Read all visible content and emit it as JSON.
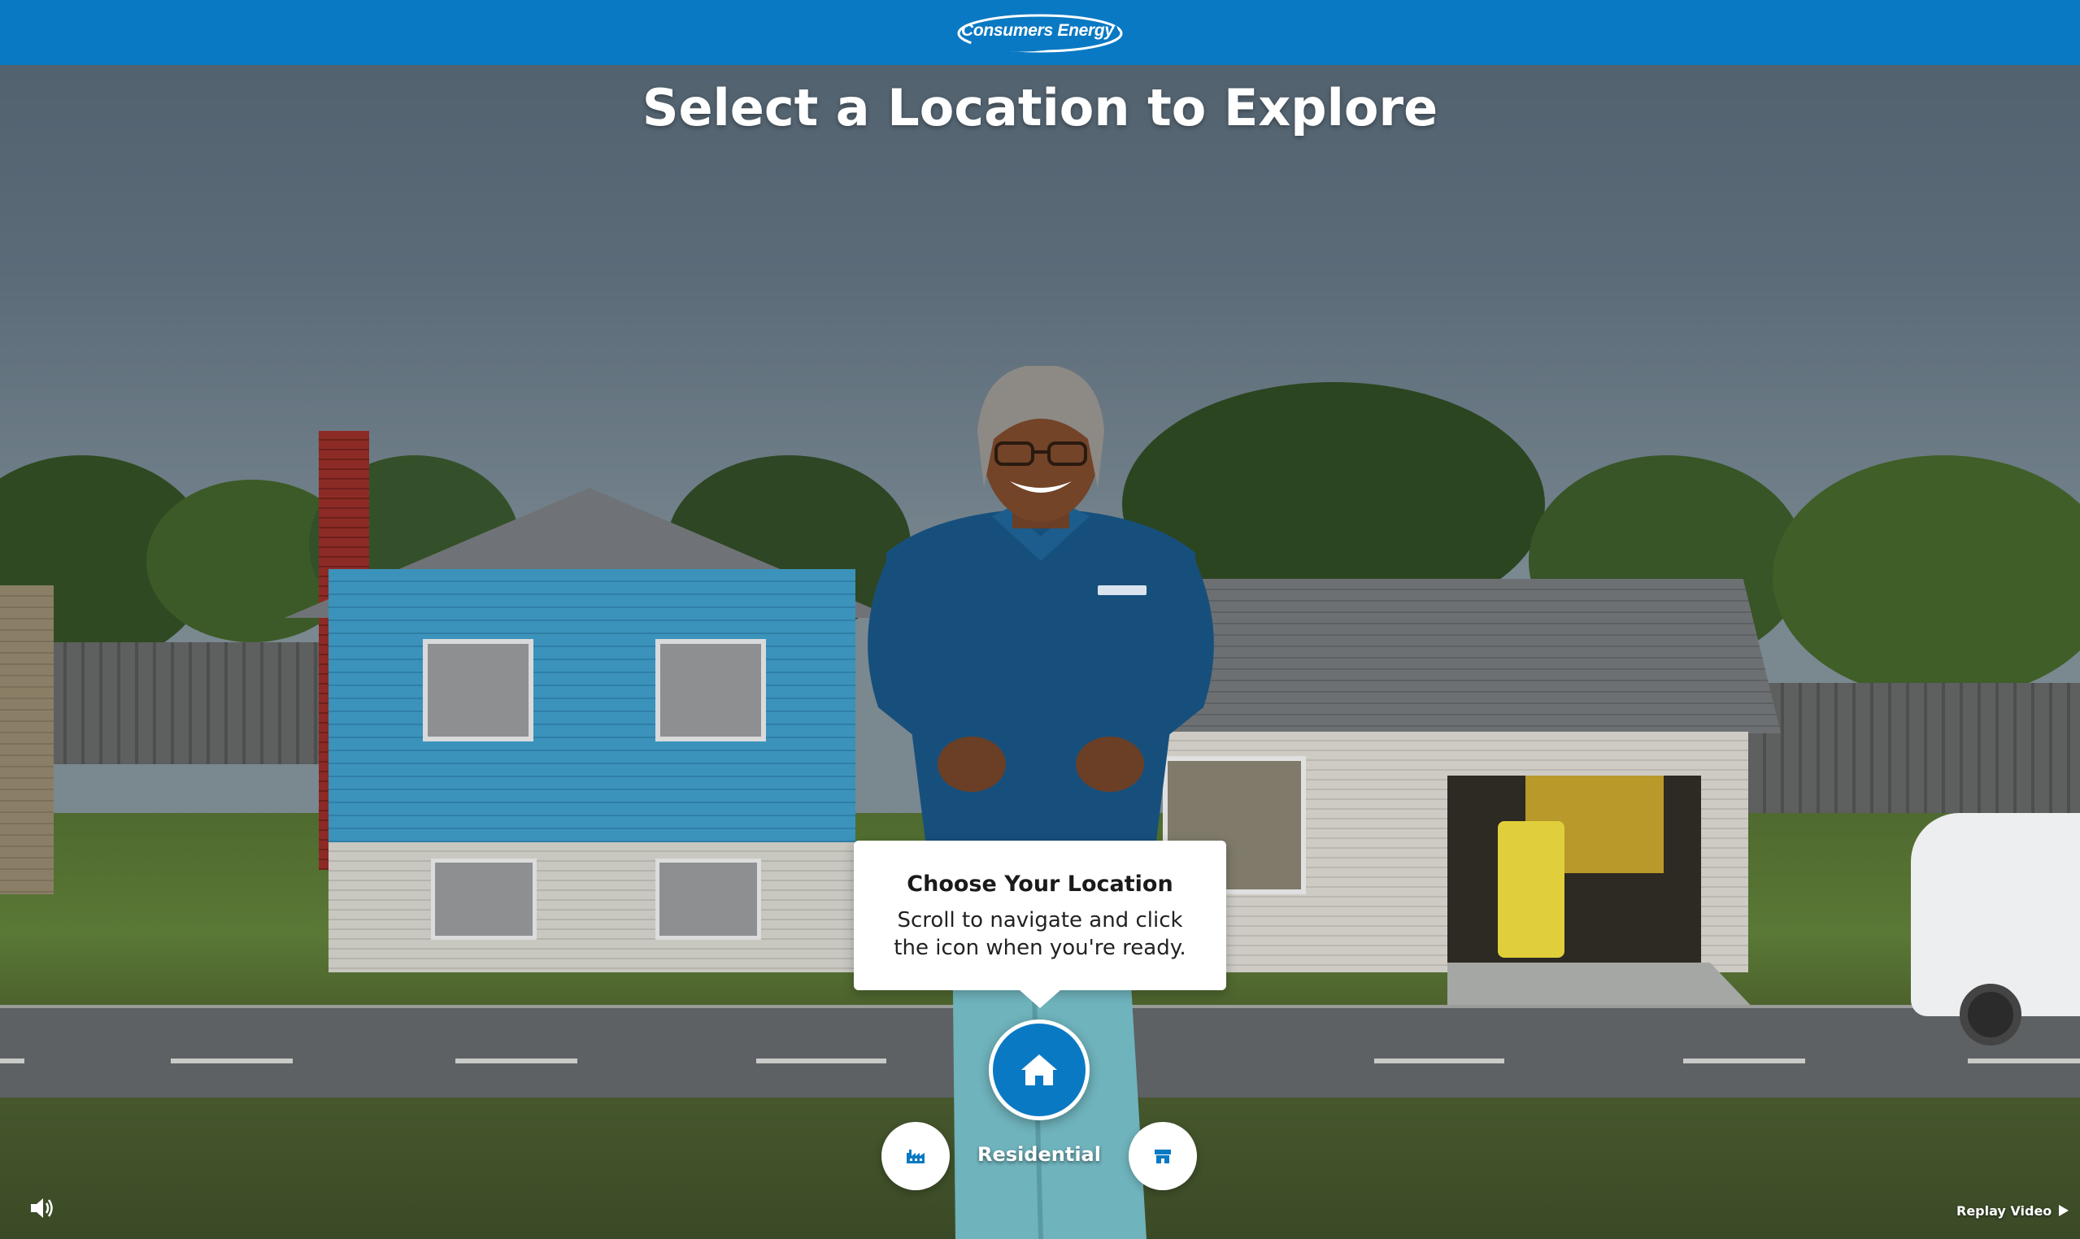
{
  "header": {
    "brand_name": "Consumers Energy",
    "brand_color": "#0a79c3"
  },
  "page": {
    "title": "Select a Location to Explore"
  },
  "callout": {
    "title": "Choose Your Location",
    "body": "Scroll to navigate and click the icon when you're ready."
  },
  "locations": {
    "selected_label": "Residential",
    "items": [
      {
        "name": "industrial",
        "icon": "factory-icon",
        "selected": false
      },
      {
        "name": "residential",
        "icon": "house-icon",
        "selected": true
      },
      {
        "name": "commercial",
        "icon": "storefront-icon",
        "selected": false
      }
    ]
  },
  "controls": {
    "volume_icon": "speaker-icon",
    "replay_label": "Replay Video",
    "replay_icon": "play-icon"
  }
}
